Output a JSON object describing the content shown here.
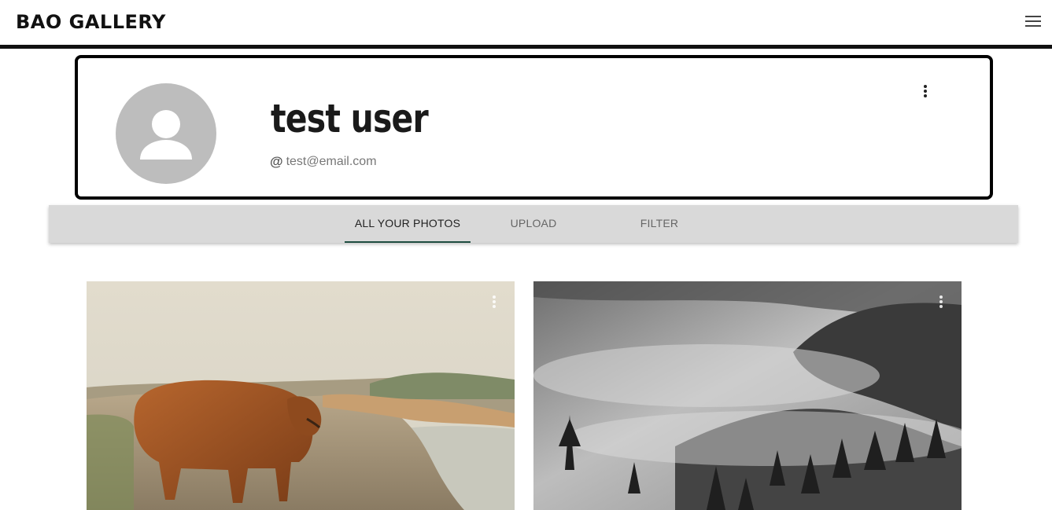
{
  "header": {
    "brand": "BAO GALLERY",
    "menu_icon": "hamburger-menu-icon"
  },
  "profile": {
    "name": "test user",
    "email": "test@email.com",
    "email_prefix_icon": "@",
    "avatar_icon": "person-icon",
    "options_icon": "more-vert-icon"
  },
  "tabs": [
    {
      "label": "ALL YOUR PHOTOS",
      "active": true
    },
    {
      "label": "UPLOAD",
      "active": false
    },
    {
      "label": "FILTER",
      "active": false
    }
  ],
  "photos": [
    {
      "subject": "highland-cow-on-rocky-shore",
      "options_icon": "more-vert-icon"
    },
    {
      "subject": "misty-forest-black-and-white",
      "options_icon": "more-vert-icon"
    }
  ],
  "colors": {
    "tab_indicator": "#1e4d40",
    "tab_bar": "#d9d9d9",
    "avatar": "#bdbdbd"
  }
}
